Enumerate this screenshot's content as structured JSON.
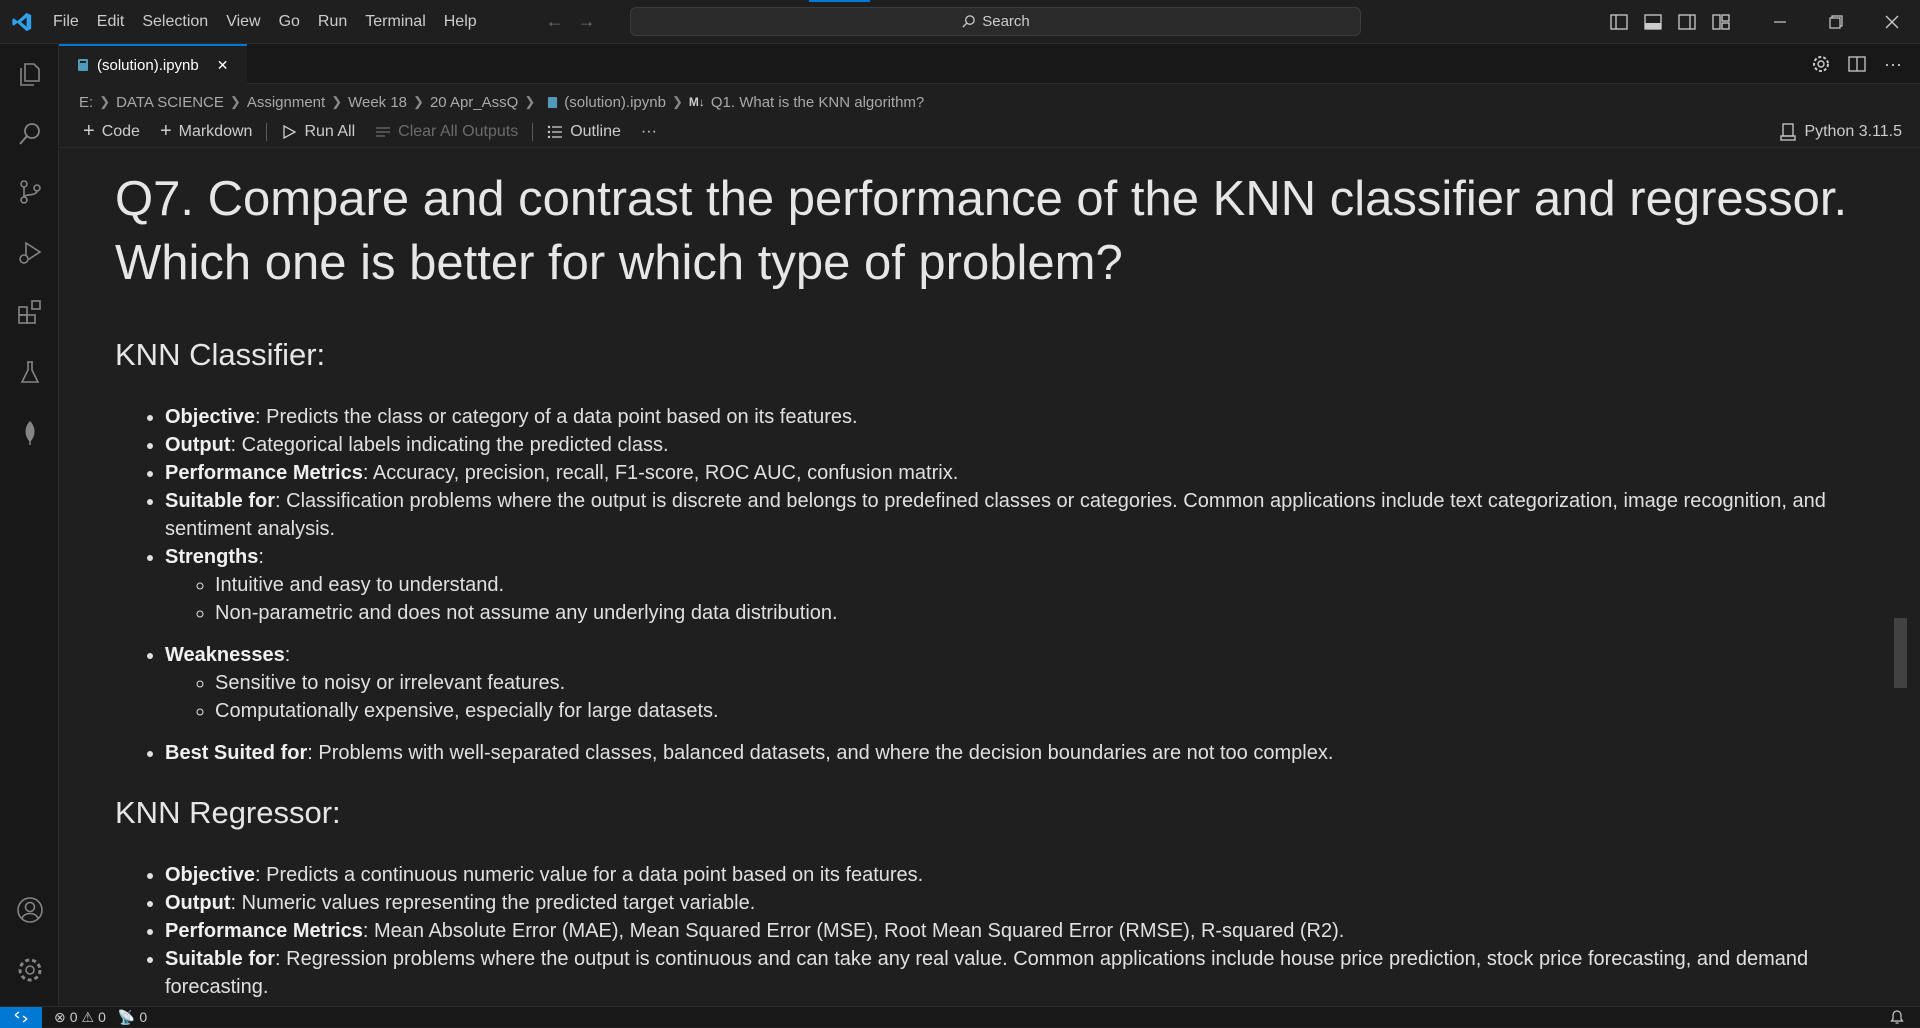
{
  "menu": [
    "File",
    "Edit",
    "Selection",
    "View",
    "Go",
    "Run",
    "Terminal",
    "Help"
  ],
  "search": {
    "label": "Search"
  },
  "tab": {
    "title": "(solution).ipynb",
    "close": "✕"
  },
  "breadcrumb": {
    "items": [
      "E:",
      "DATA SCIENCE",
      "Assignment",
      "Week 18",
      "20 Apr_AssQ",
      "(solution).ipynb",
      "Q1. What is the KNN algorithm?"
    ]
  },
  "toolbar": {
    "code": "Code",
    "markdown": "Markdown",
    "run_all": "Run All",
    "clear_outputs": "Clear All Outputs",
    "outline": "Outline",
    "more": "···",
    "kernel": "Python 3.11.5"
  },
  "notebook": {
    "question": "Q7. Compare and contrast the performance of the KNN classifier and regressor. Which one is better for which type of problem?",
    "classifier": {
      "heading": "KNN Classifier:",
      "items": [
        {
          "term": "Objective",
          "text": ": Predicts the class or category of a data point based on its features."
        },
        {
          "term": "Output",
          "text": ": Categorical labels indicating the predicted class."
        },
        {
          "term": "Performance Metrics",
          "text": ": Accuracy, precision, recall, F1-score, ROC AUC, confusion matrix."
        },
        {
          "term": "Suitable for",
          "text": ": Classification problems where the output is discrete and belongs to predefined classes or categories. Common applications include text categorization, image recognition, and sentiment analysis."
        }
      ],
      "strengths": {
        "term": "Strengths",
        "items": [
          "Intuitive and easy to understand.",
          "Non-parametric and does not assume any underlying data distribution."
        ]
      },
      "weaknesses": {
        "term": "Weaknesses",
        "items": [
          "Sensitive to noisy or irrelevant features.",
          "Computationally expensive, especially for large datasets."
        ]
      },
      "best": {
        "term": "Best Suited for",
        "text": ": Problems with well-separated classes, balanced datasets, and where the decision boundaries are not too complex."
      }
    },
    "regressor": {
      "heading": "KNN Regressor:",
      "items": [
        {
          "term": "Objective",
          "text": ": Predicts a continuous numeric value for a data point based on its features."
        },
        {
          "term": "Output",
          "text": ": Numeric values representing the predicted target variable."
        },
        {
          "term": "Performance Metrics",
          "text": ": Mean Absolute Error (MAE), Mean Squared Error (MSE), Root Mean Squared Error (RMSE), R-squared (R2)."
        },
        {
          "term": "Suitable for",
          "text": ": Regression problems where the output is continuous and can take any real value. Common applications include house price prediction, stock price forecasting, and demand forecasting."
        }
      ]
    }
  },
  "status": {
    "errors": "0",
    "warnings": "0",
    "ports": "0"
  },
  "colors": {
    "accent": "#0078d4",
    "background": "#1f1f1f"
  }
}
